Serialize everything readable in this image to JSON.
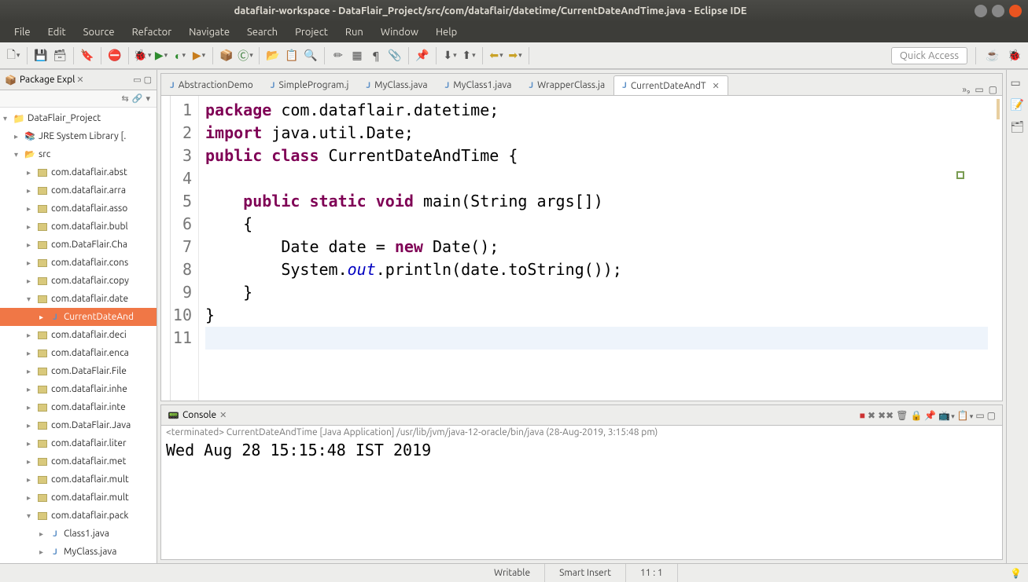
{
  "titlebar": {
    "title": "dataflair-workspace - DataFlair_Project/src/com/dataflair/datetime/CurrentDateAndTime.java - Eclipse IDE"
  },
  "menu": {
    "items": [
      "File",
      "Edit",
      "Source",
      "Refactor",
      "Navigate",
      "Search",
      "Project",
      "Run",
      "Window",
      "Help"
    ]
  },
  "quick_access": {
    "placeholder": "Quick Access"
  },
  "package_explorer": {
    "title": "Package Expl",
    "project": "DataFlair_Project",
    "jre": "JRE System Library [.",
    "src": "src",
    "packages": [
      "com.dataflair.abst",
      "com.dataflair.arra",
      "com.dataflair.asso",
      "com.dataflair.bubl",
      "com.DataFlair.Cha",
      "com.dataflair.cons",
      "com.dataflair.copy",
      "com.dataflair.date",
      "com.dataflair.deci",
      "com.dataflair.enca",
      "com.DataFlair.File",
      "com.dataflair.inhe",
      "com.dataflair.inte",
      "com.DataFlair.Java",
      "com.dataflair.liter",
      "com.dataflair.met",
      "com.dataflair.mult",
      "com.dataflair.mult",
      "com.dataflair.pack"
    ],
    "selected_file": "CurrentDateAnd",
    "pack_children": [
      "Class1.java",
      "MyClass.java"
    ]
  },
  "tabs": {
    "items": [
      "AbstractionDemo",
      "SimpleProgram.j",
      "MyClass.java",
      "MyClass1.java",
      "WrapperClass.ja",
      "CurrentDateAndT"
    ],
    "overflow": "»₉"
  },
  "code": {
    "lines": [
      "1",
      "2",
      "3",
      "4",
      "5",
      "6",
      "7",
      "8",
      "9",
      "10",
      "11"
    ],
    "l1_kw1": "package",
    "l1_rest": " com.dataflair.datetime;",
    "l2_kw1": "import",
    "l2_rest": " java.util.Date;",
    "l3_kw1": "public",
    "l3_kw2": "class",
    "l3_rest": " CurrentDateAndTime {",
    "l5_ind": "    ",
    "l5_kw1": "public",
    "l5_kw2": "static",
    "l5_kw3": "void",
    "l5_rest": " main(String args[])",
    "l6": "    {",
    "l7a": "        Date date = ",
    "l7_kw": "new",
    "l7b": " Date();",
    "l8a": "        System.",
    "l8_fld": "out",
    "l8b": ".println(date.toString());",
    "l9": "    }",
    "l10": "}"
  },
  "console": {
    "title": "Console",
    "terminated": "<terminated> CurrentDateAndTime [Java Application] /usr/lib/jvm/java-12-oracle/bin/java (28-Aug-2019, 3:15:48 pm)",
    "output": "Wed Aug 28 15:15:48 IST 2019"
  },
  "statusbar": {
    "writable": "Writable",
    "insert": "Smart Insert",
    "pos": "11 : 1"
  }
}
